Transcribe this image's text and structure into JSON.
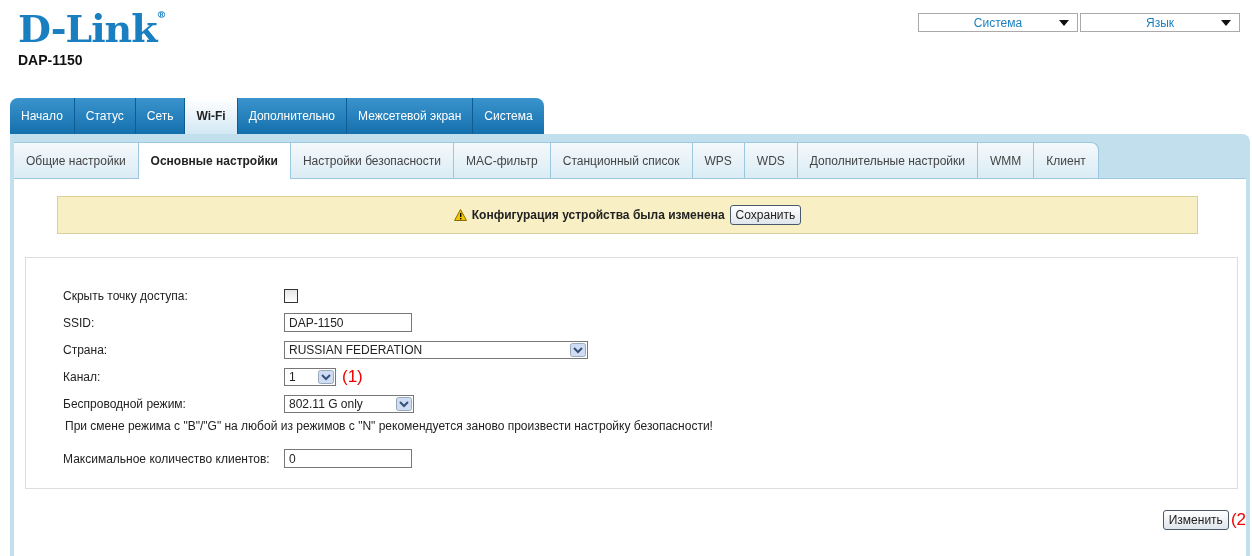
{
  "header": {
    "logo": "D-Link",
    "logo_mark": "®",
    "model": "DAP-1150",
    "menus": [
      {
        "label": "Система"
      },
      {
        "label": "Язык"
      }
    ]
  },
  "main_tabs": [
    {
      "label": "Начало",
      "selected": false
    },
    {
      "label": "Статус",
      "selected": false
    },
    {
      "label": "Сеть",
      "selected": false
    },
    {
      "label": "Wi-Fi",
      "selected": true
    },
    {
      "label": "Дополнительно",
      "selected": false
    },
    {
      "label": "Межсетевой экран",
      "selected": false
    },
    {
      "label": "Система",
      "selected": false
    }
  ],
  "sub_tabs": [
    {
      "label": "Общие настройки",
      "selected": false
    },
    {
      "label": "Основные настройки",
      "selected": true
    },
    {
      "label": "Настройки безопасности",
      "selected": false
    },
    {
      "label": "MAC-фильтр",
      "selected": false
    },
    {
      "label": "Станционный список",
      "selected": false
    },
    {
      "label": "WPS",
      "selected": false
    },
    {
      "label": "WDS",
      "selected": false
    },
    {
      "label": "Дополнительные настройки",
      "selected": false
    },
    {
      "label": "WMM",
      "selected": false
    },
    {
      "label": "Клиент",
      "selected": false
    }
  ],
  "notice": {
    "text": "Конфигурация устройства была изменена",
    "button": "Сохранить"
  },
  "form": {
    "fields": [
      {
        "kind": "checkbox",
        "label": "Скрыть точку доступа:",
        "checked": false
      },
      {
        "kind": "text",
        "label": "SSID:",
        "value": "DAP-1150"
      },
      {
        "kind": "select",
        "label": "Страна:",
        "value": "RUSSIAN FEDERATION"
      },
      {
        "kind": "select",
        "label": "Канал:",
        "value": "1",
        "annotation": "(1)"
      },
      {
        "kind": "select",
        "label": "Беспроводной режим:",
        "value": "802.11 G only"
      },
      {
        "kind": "note",
        "text": "При смене режима с \"B\"/\"G\" на любой из режимов с \"N\" рекомендуется заново произвести настройку безопасности!"
      },
      {
        "kind": "text",
        "label": "Максимальное количество клиентов:",
        "value": "0"
      }
    ]
  },
  "apply": {
    "button": "Изменить",
    "annotation": "(2"
  }
}
